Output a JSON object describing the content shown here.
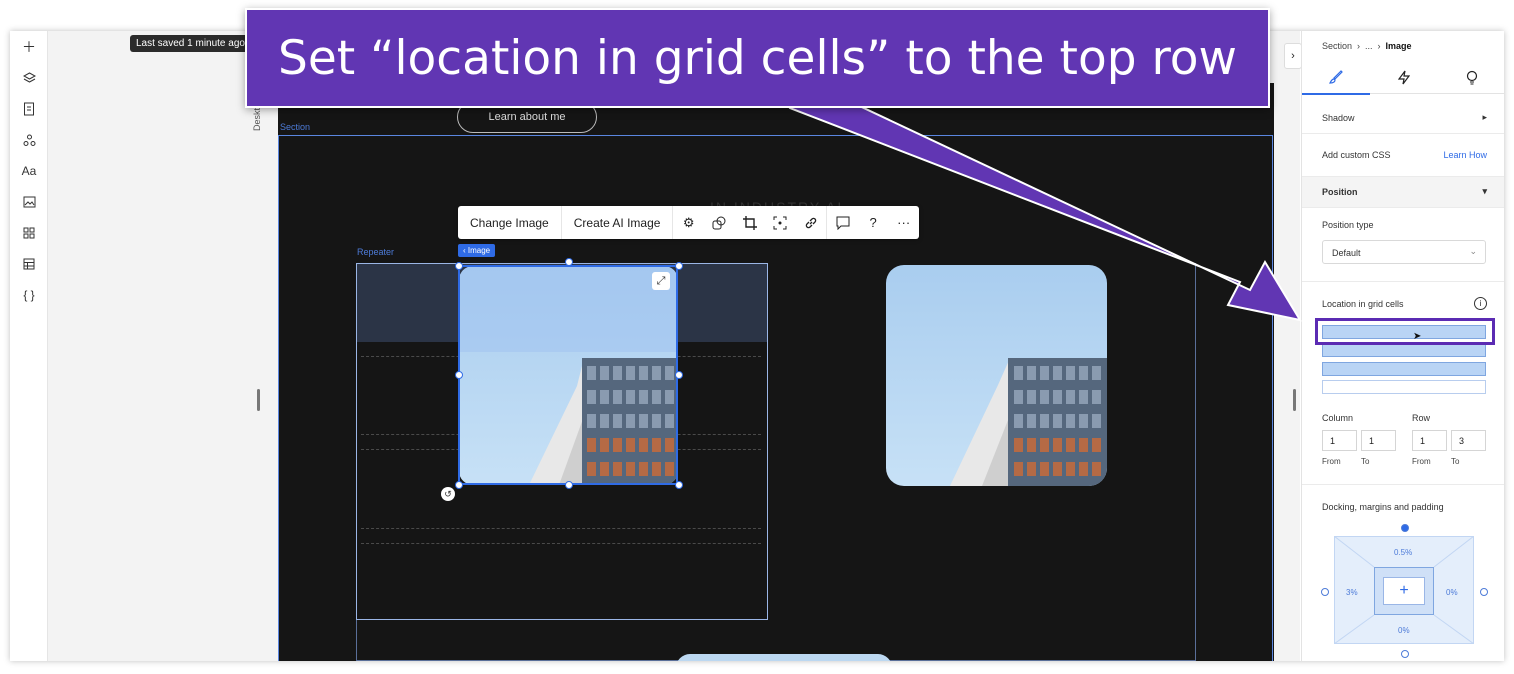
{
  "app": {
    "saved_tooltip": "Last saved 1 minute ago",
    "device_label": "Desktop (Pr",
    "left_toolbar_icons": [
      "plus-icon",
      "layers-icon",
      "pages-icon",
      "components-icon",
      "typography-icon",
      "media-icon",
      "apps-icon",
      "table-icon",
      "code-icon"
    ]
  },
  "canvas": {
    "section_label": "Section",
    "learn_button": "Learn about me",
    "repeater_label": "Repeater",
    "image_tag": "Image",
    "ghost_text": "IN INDUSTRY AI",
    "toolbar": {
      "change_image": "Change Image",
      "create_ai_image": "Create AI Image",
      "icons": [
        "settings-icon",
        "mask-icon",
        "crop-icon",
        "focal-point-icon",
        "link-icon",
        "comment-icon",
        "help-icon",
        "more-icon"
      ],
      "help_glyph": "?",
      "more_glyph": "···"
    }
  },
  "panel": {
    "breadcrumb": {
      "a": "Section",
      "b": "...",
      "c": "Image"
    },
    "tabs": [
      "design-brush-icon",
      "interactions-bolt-icon",
      "ai-bulb-icon"
    ],
    "shadow_label": "Shadow",
    "css_label": "Add custom CSS",
    "css_link": "Learn How",
    "position_header": "Position",
    "position_type_label": "Position type",
    "position_type_value": "Default",
    "grid_label": "Location in grid cells",
    "column_label": "Column",
    "row_label": "Row",
    "column_from": "1",
    "column_to": "1",
    "row_from": "1",
    "row_to": "3",
    "from_label": "From",
    "to_label": "To",
    "docking_label": "Docking, margins and padding",
    "margin_top": "0.5%",
    "margin_left": "3%",
    "margin_right": "0%",
    "margin_bottom": "0%"
  },
  "banner": {
    "text": "Set “location in grid cells” to the top row",
    "color": "#6136b3"
  }
}
